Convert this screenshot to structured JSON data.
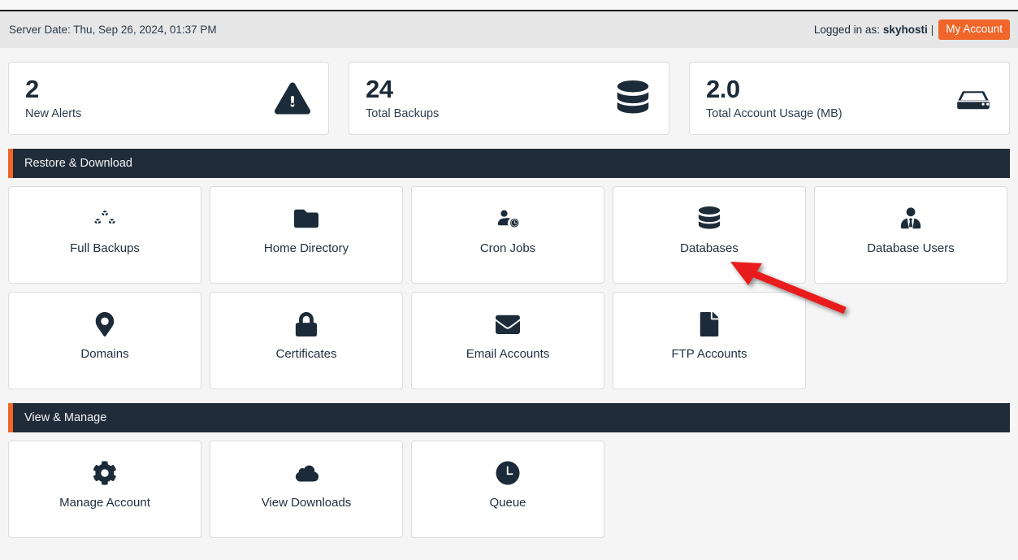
{
  "serverbar": {
    "server_date": "Server Date: Thu, Sep 26, 2024, 01:37 PM",
    "logged_in_label": "Logged in as:",
    "username": "skyhosti",
    "separator": "|",
    "my_account_button": "My Account",
    "accent_color": "#f0652a"
  },
  "stats": [
    {
      "value": "2",
      "label": "New Alerts",
      "icon": "warning-triangle-icon"
    },
    {
      "value": "24",
      "label": "Total Backups",
      "icon": "database-icon"
    },
    {
      "value": "2.0",
      "label": "Total Account Usage (MB)",
      "icon": "hard-drive-icon"
    }
  ],
  "sections": [
    {
      "title": "Restore & Download",
      "rows": [
        [
          {
            "label": "Full Backups",
            "icon": "boxes-icon"
          },
          {
            "label": "Home Directory",
            "icon": "folder-icon"
          },
          {
            "label": "Cron Jobs",
            "icon": "user-clock-icon"
          },
          {
            "label": "Databases",
            "icon": "database-icon"
          },
          {
            "label": "Database Users",
            "icon": "user-tie-icon"
          }
        ],
        [
          {
            "label": "Domains",
            "icon": "map-marker-icon"
          },
          {
            "label": "Certificates",
            "icon": "lock-icon"
          },
          {
            "label": "Email Accounts",
            "icon": "envelope-icon"
          },
          {
            "label": "FTP Accounts",
            "icon": "file-icon"
          }
        ]
      ]
    },
    {
      "title": "View & Manage",
      "rows": [
        [
          {
            "label": "Manage Account",
            "icon": "gear-icon"
          },
          {
            "label": "View Downloads",
            "icon": "cloud-download-icon"
          },
          {
            "label": "Queue",
            "icon": "clock-icon"
          }
        ]
      ]
    }
  ],
  "annotation": {
    "type": "arrow",
    "color": "#e81d1d",
    "points_to": "Databases"
  }
}
